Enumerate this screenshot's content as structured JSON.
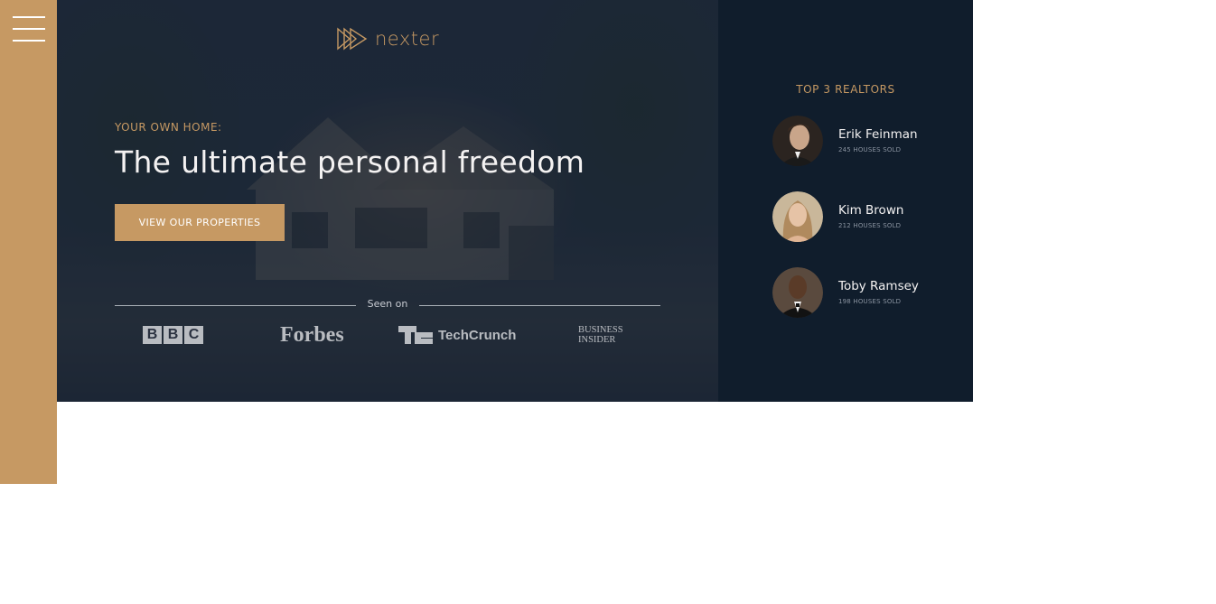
{
  "sidebar": {
    "menu_icon": "hamburger-menu-icon"
  },
  "header": {
    "logo_text": "nexter",
    "logo_icon": "triple-play-icon"
  },
  "hero": {
    "eyebrow": "YOUR OWN HOME:",
    "headline": "The ultimate personal freedom",
    "cta_label": "VIEW OUR PROPERTIES",
    "seen_on_label": "Seen on",
    "press": {
      "bbc": [
        "B",
        "B",
        "C"
      ],
      "forbes": "Forbes",
      "techcrunch": "TechCrunch",
      "business_insider_line1": "BUSINESS",
      "business_insider_line2": "INSIDER"
    }
  },
  "realtors": {
    "title": "TOP 3 REALTORS",
    "items": [
      {
        "name": "Erik Feinman",
        "sold": "245 HOUSES SOLD"
      },
      {
        "name": "Kim Brown",
        "sold": "212 HOUSES SOLD"
      },
      {
        "name": "Toby Ramsey",
        "sold": "198 HOUSES SOLD"
      }
    ]
  },
  "colors": {
    "accent": "#c69963",
    "dark_navy": "#101d2c",
    "light_text": "#f4f2f2"
  }
}
